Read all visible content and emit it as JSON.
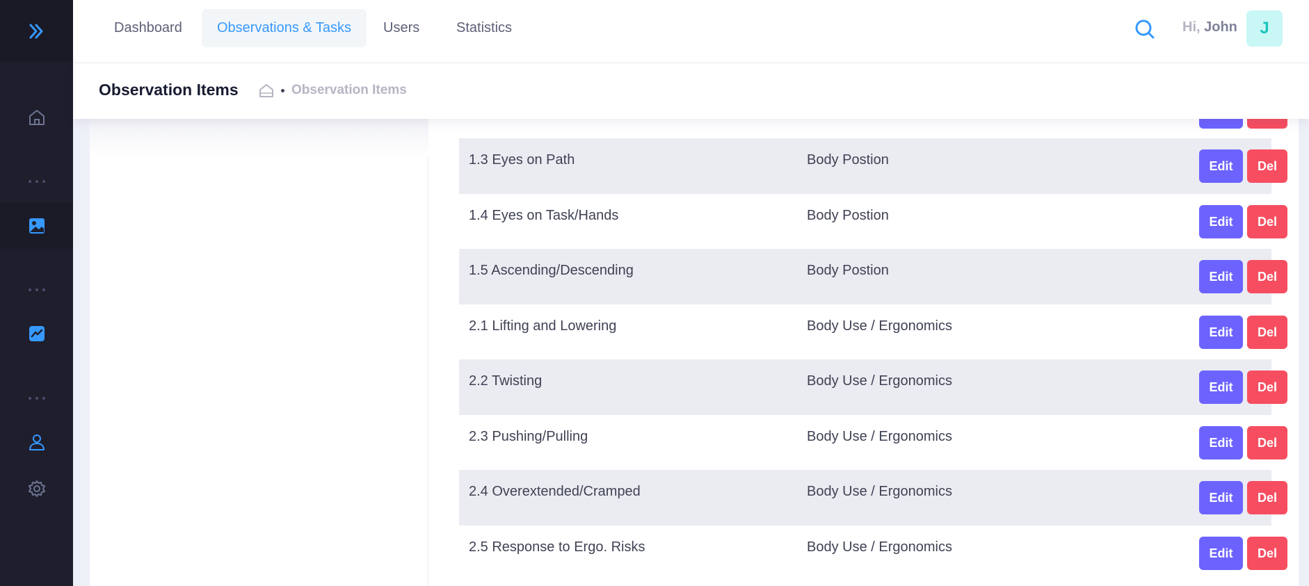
{
  "header": {
    "nav": [
      {
        "label": "Dashboard"
      },
      {
        "label": "Observations & Tasks"
      },
      {
        "label": "Users"
      },
      {
        "label": "Statistics"
      }
    ],
    "greeting_prefix": "Hi,",
    "user_name": "John",
    "avatar_initial": "J"
  },
  "subheader": {
    "title": "Observation Items",
    "breadcrumb_current": "Observation Items"
  },
  "sidebar": {
    "icons": [
      "double-chevron-right-icon",
      "home-icon",
      "image-icon",
      "chart-icon",
      "user-icon",
      "gear-icon"
    ]
  },
  "table": {
    "edit_label": "Edit",
    "del_label": "Del",
    "rows": [
      {
        "name": "1.3 Eyes on Path",
        "category": "Body Postion"
      },
      {
        "name": "1.4 Eyes on Task/Hands",
        "category": "Body Postion"
      },
      {
        "name": "1.5 Ascending/Descending",
        "category": "Body Postion"
      },
      {
        "name": "2.1 Lifting and Lowering",
        "category": "Body Use / Ergonomics"
      },
      {
        "name": "2.2 Twisting",
        "category": "Body Use / Ergonomics"
      },
      {
        "name": "2.3 Pushing/Pulling",
        "category": "Body Use / Ergonomics"
      },
      {
        "name": "2.4 Overextended/Cramped",
        "category": "Body Use / Ergonomics"
      },
      {
        "name": "2.5 Response to Ergo. Risks",
        "category": "Body Use / Ergonomics"
      }
    ]
  },
  "colors": {
    "accent": "#3699ff",
    "edit": "#6c63ff",
    "delete": "#f64e60",
    "sidebar": "#1e1e2d"
  }
}
